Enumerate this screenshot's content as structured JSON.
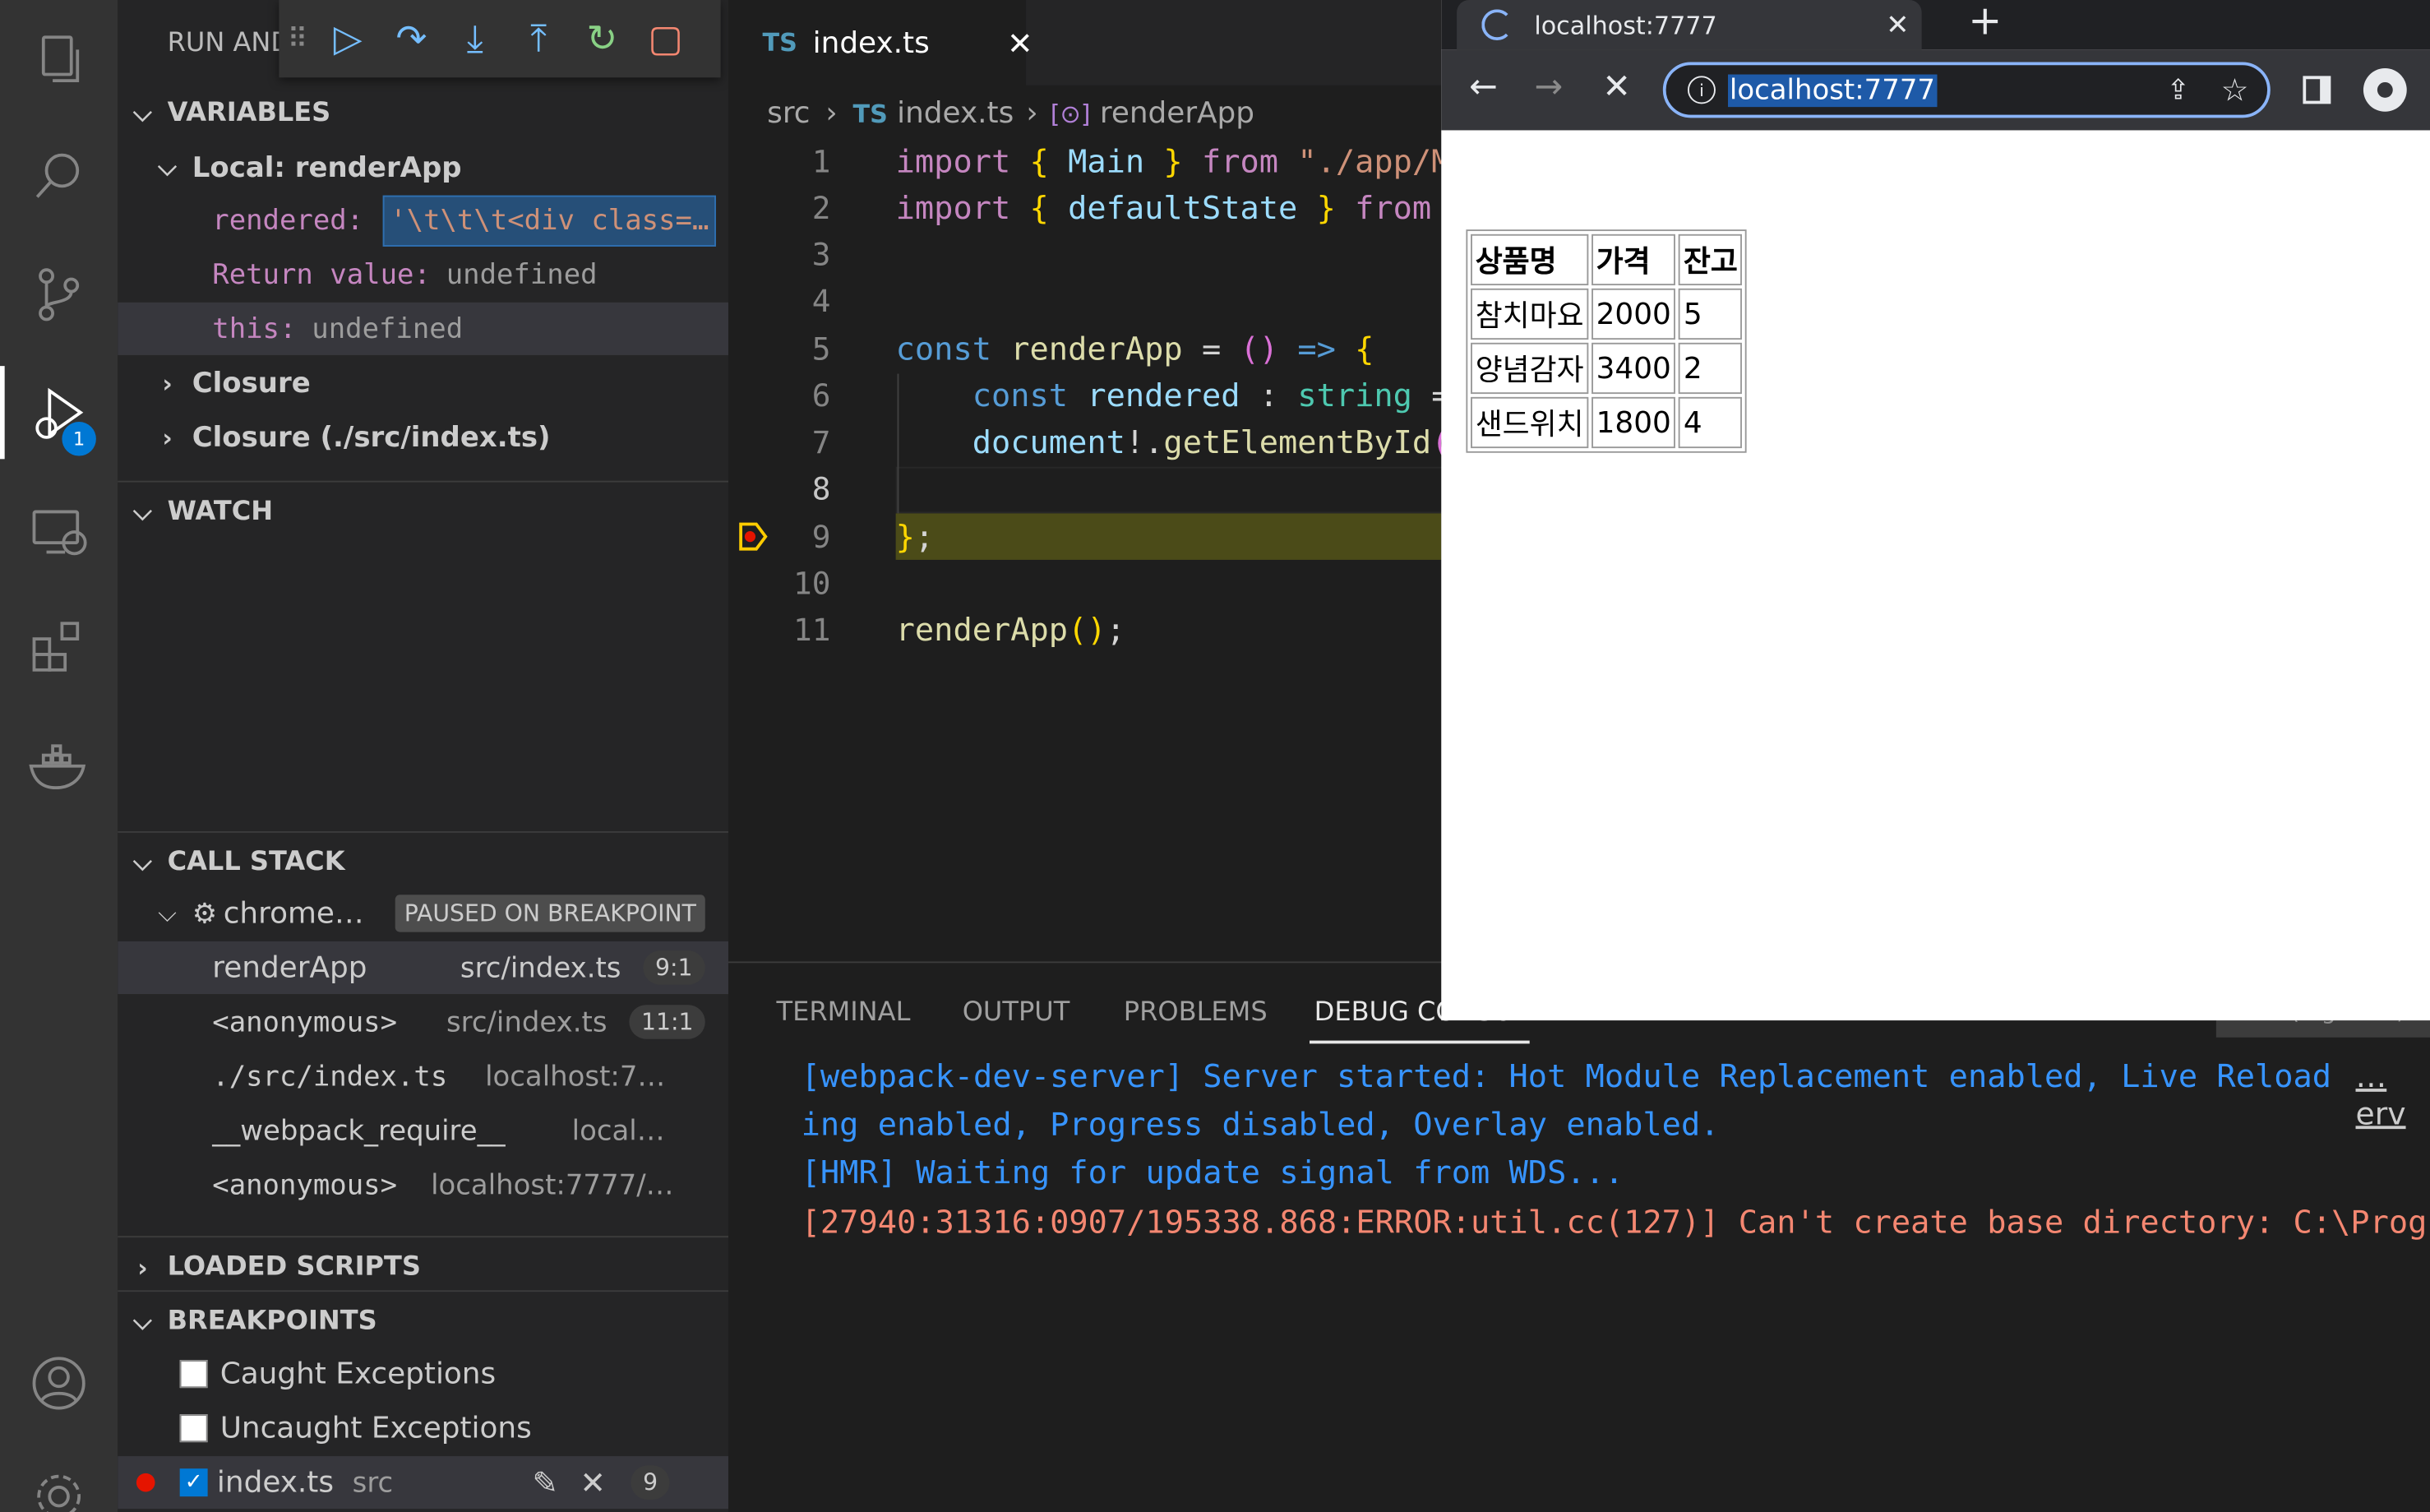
{
  "activity_bar": {
    "debug_badge": "1"
  },
  "debug_panel": {
    "title": "RUN AND",
    "variables": {
      "header": "VARIABLES",
      "scope_local": "Local: renderApp",
      "rows": [
        {
          "name": "rendered:",
          "value": "'\\t\\t\\t<div class=…"
        },
        {
          "name": "Return value:",
          "value": "undefined"
        },
        {
          "name": "this:",
          "value": "undefined"
        }
      ],
      "closure": "Closure",
      "closure_file": "Closure (./src/index.ts)"
    },
    "watch": {
      "header": "WATCH"
    },
    "call_stack": {
      "header": "CALL STACK",
      "session": "chrome…",
      "paused_label": "PAUSED ON BREAKPOINT",
      "frames": [
        {
          "name": "renderApp",
          "source": "src/index.ts",
          "pos": "9:1"
        },
        {
          "name": "<anonymous>",
          "source": "src/index.ts",
          "pos": "11:1"
        },
        {
          "name": "./src/index.ts",
          "source": "localhost:7…",
          "pos": ""
        },
        {
          "name": "__webpack_require__",
          "source": "local…",
          "pos": ""
        },
        {
          "name": "<anonymous>",
          "source": "localhost:7777/…",
          "pos": ""
        }
      ]
    },
    "loaded_scripts": {
      "header": "LOADED SCRIPTS"
    },
    "breakpoints": {
      "header": "BREAKPOINTS",
      "items": [
        {
          "label": "Caught Exceptions",
          "checked": false
        },
        {
          "label": "Uncaught Exceptions",
          "checked": false
        },
        {
          "label": "index.ts",
          "path": "src",
          "line": "9",
          "checked": true
        }
      ]
    }
  },
  "editor": {
    "tab_label": "index.ts",
    "tab_lang": "TS",
    "breadcrumb": {
      "folder": "src",
      "file": "index.ts",
      "symbol": "renderApp"
    },
    "line_numbers": [
      "1",
      "2",
      "3",
      "4",
      "5",
      "6",
      "7",
      "8",
      "9",
      "10",
      "11"
    ],
    "current_line": "9"
  },
  "panel": {
    "tabs": [
      "TERMINAL",
      "OUTPUT",
      "PROBLEMS",
      "DEBUG CONSOLE"
    ],
    "active_tab": "DEBUG CONSOLE",
    "filter_placeholder": "Filter (e.g. text,",
    "lines": [
      "[webpack-dev-server] Server started: Hot Module Replacement enabled, Live Reload",
      "ing enabled, Progress disabled, Overlay enabled.",
      "[HMR] Waiting for update signal from WDS...",
      "[27940:31316:0907/195338.868:ERROR:util.cc(127)] Can't create base directory: C:\\Progr"
    ],
    "truncated_source": "…erv"
  },
  "browser": {
    "tab_title": "localhost:7777",
    "url": "localhost:7777",
    "table": {
      "headers": [
        "상품명",
        "가격",
        "잔고"
      ],
      "rows": [
        [
          "참치마요",
          "2000",
          "5"
        ],
        [
          "양념감자",
          "3400",
          "2"
        ],
        [
          "샌드위치",
          "1800",
          "4"
        ]
      ]
    }
  },
  "colors": {
    "accent": "#0078d4",
    "breakpoint": "#e51400",
    "current_line_bg": "#4b4b18",
    "console_info": "#3794ff",
    "console_error": "#f48771"
  }
}
